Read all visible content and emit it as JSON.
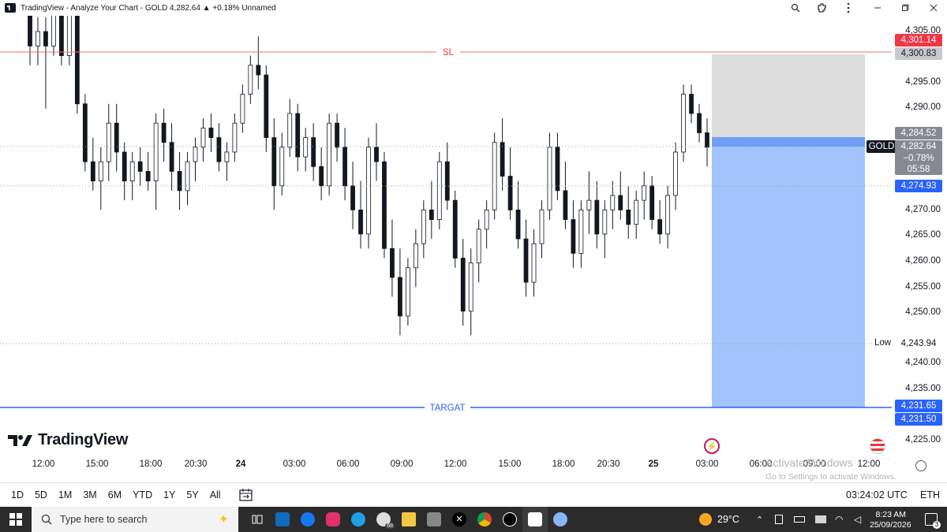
{
  "window": {
    "title": "TradingView - Analyze Your Chart - GOLD 4,282.64 ▲ +0.18% Unnamed",
    "controls": [
      "zoom-icon",
      "extension-icon",
      "more-icon",
      "minimize-icon",
      "restore-icon",
      "close-icon"
    ]
  },
  "chart_data": {
    "type": "candlestick",
    "symbol": "GOLD",
    "price_axis_ticks": [
      "4,305.00",
      "4,295.00",
      "4,290.00",
      "4,270.00",
      "4,265.00",
      "4,260.00",
      "4,255.00",
      "4,250.00",
      "4,240.00",
      "4,235.00",
      "4,225.00"
    ],
    "time_axis_ticks": [
      "12:00",
      "15:00",
      "18:00",
      "20:30",
      "24",
      "03:00",
      "06:00",
      "09:00",
      "12:00",
      "15:00",
      "18:00",
      "20:30",
      "25",
      "03:00",
      "06:00",
      "09:00",
      "12:00"
    ],
    "ylim": [
      4222,
      4307
    ],
    "lines": {
      "sl": {
        "label": "SL",
        "price": 4300.83,
        "color": "#e57373"
      },
      "target": {
        "label": "TARGAT",
        "price": 4231.65,
        "color": "#2962ff"
      }
    },
    "candles": [
      [
        4312,
        4316,
        4300,
        4304
      ],
      [
        4304,
        4310,
        4300,
        4307
      ],
      [
        4307,
        4310,
        4291,
        4304
      ],
      [
        4304,
        4316,
        4302,
        4314
      ],
      [
        4314,
        4320,
        4300,
        4302
      ],
      [
        4302,
        4318,
        4300,
        4315
      ],
      [
        4315,
        4318,
        4290,
        4292
      ],
      [
        4292,
        4294,
        4278,
        4280
      ],
      [
        4280,
        4285,
        4274,
        4276
      ],
      [
        4276,
        4283,
        4270,
        4280
      ],
      [
        4280,
        4292,
        4276,
        4288
      ],
      [
        4288,
        4292,
        4278,
        4282
      ],
      [
        4282,
        4284,
        4272,
        4276
      ],
      [
        4276,
        4282,
        4272,
        4280
      ],
      [
        4280,
        4283,
        4275,
        4278
      ],
      [
        4278,
        4282,
        4274,
        4276
      ],
      [
        4276,
        4290,
        4270,
        4288
      ],
      [
        4288,
        4291,
        4280,
        4284
      ],
      [
        4284,
        4288,
        4274,
        4278
      ],
      [
        4278,
        4282,
        4270,
        4274
      ],
      [
        4274,
        4282,
        4271,
        4280
      ],
      [
        4280,
        4285,
        4276,
        4283
      ],
      [
        4283,
        4289,
        4280,
        4287
      ],
      [
        4287,
        4290,
        4282,
        4285
      ],
      [
        4285,
        4288,
        4278,
        4280
      ],
      [
        4280,
        4284,
        4276,
        4282
      ],
      [
        4282,
        4290,
        4280,
        4288
      ],
      [
        4288,
        4296,
        4286,
        4294
      ],
      [
        4294,
        4302,
        4292,
        4300
      ],
      [
        4300,
        4306,
        4295,
        4298
      ],
      [
        4298,
        4300,
        4282,
        4285
      ],
      [
        4285,
        4289,
        4270,
        4275
      ],
      [
        4275,
        4286,
        4273,
        4283
      ],
      [
        4283,
        4293,
        4281,
        4290
      ],
      [
        4290,
        4292,
        4278,
        4281
      ],
      [
        4281,
        4287,
        4278,
        4285
      ],
      [
        4285,
        4288,
        4276,
        4279
      ],
      [
        4279,
        4283,
        4272,
        4275
      ],
      [
        4275,
        4290,
        4273,
        4288
      ],
      [
        4288,
        4290,
        4280,
        4283
      ],
      [
        4283,
        4287,
        4272,
        4275
      ],
      [
        4275,
        4280,
        4266,
        4270
      ],
      [
        4270,
        4276,
        4262,
        4265
      ],
      [
        4265,
        4285,
        4262,
        4283
      ],
      [
        4283,
        4288,
        4276,
        4280
      ],
      [
        4280,
        4282,
        4260,
        4262
      ],
      [
        4262,
        4268,
        4252,
        4256
      ],
      [
        4256,
        4262,
        4244,
        4248
      ],
      [
        4248,
        4260,
        4246,
        4258
      ],
      [
        4258,
        4266,
        4254,
        4263
      ],
      [
        4263,
        4272,
        4260,
        4270
      ],
      [
        4270,
        4276,
        4264,
        4268
      ],
      [
        4268,
        4282,
        4266,
        4280
      ],
      [
        4280,
        4284,
        4270,
        4272
      ],
      [
        4272,
        4274,
        4258,
        4260
      ],
      [
        4260,
        4264,
        4246,
        4249
      ],
      [
        4249,
        4262,
        4244,
        4259
      ],
      [
        4259,
        4268,
        4255,
        4266
      ],
      [
        4266,
        4272,
        4262,
        4270
      ],
      [
        4270,
        4286,
        4268,
        4284
      ],
      [
        4284,
        4289,
        4274,
        4277
      ],
      [
        4277,
        4283,
        4268,
        4270
      ],
      [
        4270,
        4276,
        4262,
        4264
      ],
      [
        4264,
        4268,
        4252,
        4255
      ],
      [
        4255,
        4266,
        4252,
        4263
      ],
      [
        4263,
        4272,
        4260,
        4270
      ],
      [
        4270,
        4286,
        4268,
        4283
      ],
      [
        4283,
        4286,
        4272,
        4274
      ],
      [
        4274,
        4280,
        4266,
        4268
      ],
      [
        4268,
        4272,
        4258,
        4261
      ],
      [
        4261,
        4272,
        4258,
        4270
      ],
      [
        4270,
        4278,
        4265,
        4272
      ],
      [
        4272,
        4276,
        4262,
        4265
      ],
      [
        4265,
        4272,
        4260,
        4270
      ],
      [
        4270,
        4276,
        4266,
        4273
      ],
      [
        4273,
        4278,
        4268,
        4270
      ],
      [
        4270,
        4275,
        4264,
        4267
      ],
      [
        4267,
        4274,
        4264,
        4272
      ],
      [
        4272,
        4278,
        4268,
        4275
      ],
      [
        4275,
        4277,
        4266,
        4268
      ],
      [
        4268,
        4272,
        4263,
        4265
      ],
      [
        4265,
        4275,
        4262,
        4273
      ],
      [
        4273,
        4284,
        4270,
        4282
      ],
      [
        4282,
        4296,
        4280,
        4294
      ],
      [
        4294,
        4296,
        4288,
        4290
      ],
      [
        4290,
        4292,
        4284,
        4286
      ],
      [
        4286,
        4289,
        4279,
        4283
      ]
    ]
  },
  "price_labels": [
    {
      "value": "4,301.14",
      "bg": "#f23645",
      "fg": "#ffffff",
      "price": 4301.14
    },
    {
      "value": "4,300.83",
      "bg": "#c7c9cd",
      "fg": "#131722",
      "price": 4299.4
    },
    {
      "value": "4,284.52",
      "bg": "#868993",
      "fg": "#ffffff",
      "price": 4284.52
    },
    {
      "value": "4,274.93",
      "bg": "#2962ff",
      "fg": "#ffffff",
      "price": 4274.93
    },
    {
      "value": "4,243.94",
      "bg": "#ffffff",
      "fg": "#131722",
      "price": 4243.94
    },
    {
      "value": "4,231.65",
      "bg": "#2962ff",
      "fg": "#ffffff",
      "price": 4232.1
    },
    {
      "value": "4,231.50",
      "bg": "#2962ff",
      "fg": "#ffffff",
      "price": 4228.6
    }
  ],
  "current": {
    "symbol": "GOLD",
    "price": "4,282.64",
    "change": "−0.78%",
    "countdown": "05:58"
  },
  "low_label": "Low",
  "brand": "TradingView",
  "toolbar": {
    "ranges": [
      "1D",
      "5D",
      "1M",
      "3M",
      "6M",
      "YTD",
      "1Y",
      "5Y",
      "All"
    ],
    "clock": "03:24:02 UTC",
    "session": "ETH"
  },
  "watermark": {
    "line1": "Activate Windows",
    "line2": "Go to Settings to activate Windows."
  },
  "taskbar": {
    "search_placeholder": "Type here to search",
    "weather": "29°C",
    "time": "8:23 AM",
    "date": "25/09/2026",
    "notifications": "3",
    "badge": "68"
  }
}
